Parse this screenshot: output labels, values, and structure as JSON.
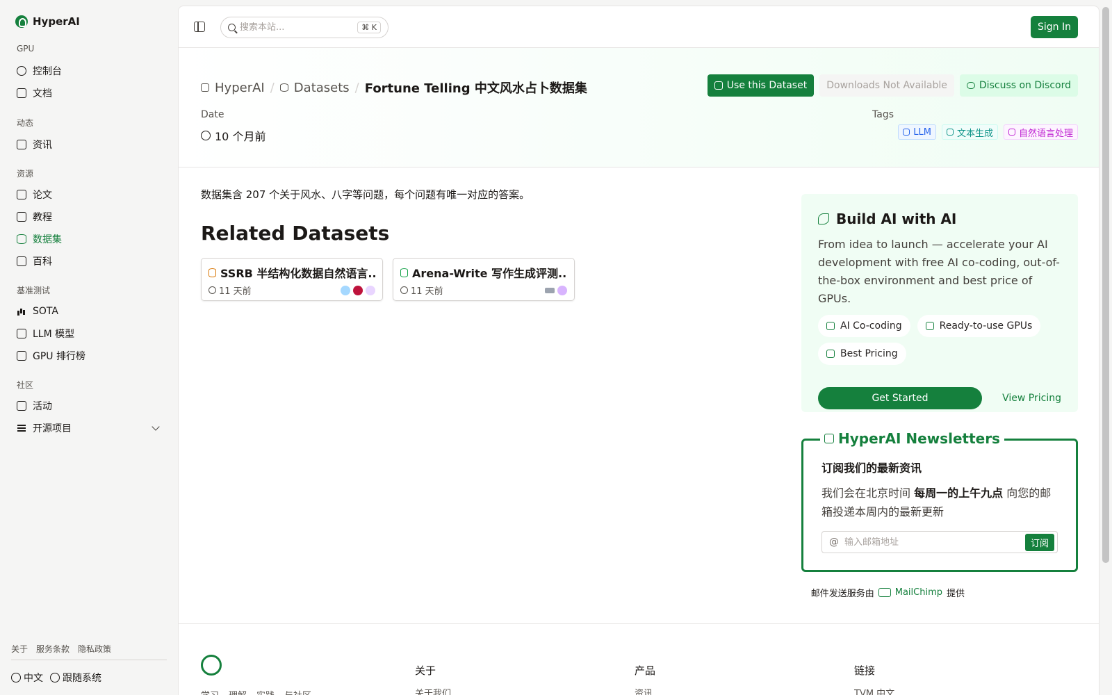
{
  "brand": "HyperAI",
  "sidebar": {
    "sections": [
      {
        "title": "GPU",
        "items": [
          {
            "label": "控制台"
          },
          {
            "label": "文档"
          }
        ]
      },
      {
        "title": "动态",
        "items": [
          {
            "label": "资讯"
          }
        ]
      },
      {
        "title": "资源",
        "items": [
          {
            "label": "论文"
          },
          {
            "label": "教程"
          },
          {
            "label": "数据集",
            "active": true
          },
          {
            "label": "百科"
          }
        ]
      },
      {
        "title": "基准测试",
        "items": [
          {
            "label": "SOTA"
          },
          {
            "label": "LLM 模型"
          },
          {
            "label": "GPU 排行榜"
          }
        ]
      },
      {
        "title": "社区",
        "items": [
          {
            "label": "活动"
          },
          {
            "label": "开源项目"
          }
        ]
      }
    ],
    "footer_links": [
      "关于",
      "服务条款",
      "隐私政策"
    ],
    "language": "中文",
    "theme": "跟随系统"
  },
  "topbar": {
    "search_placeholder": "搜索本站...",
    "search_shortcut": "⌘ K",
    "signin_label": "Sign In"
  },
  "hero": {
    "breadcrumb": [
      "HyperAI",
      "Datasets",
      "Fortune Telling 中文风水占卜数据集"
    ],
    "buttons": {
      "use": "Use this Dataset",
      "downloads": "Downloads Not Available",
      "discord": "Discuss on Discord"
    },
    "date_label": "Date",
    "date_value": "10 个月前",
    "tags_label": "Tags",
    "tags": [
      {
        "label": "LLM",
        "color": "#2563eb"
      },
      {
        "label": "文本生成",
        "color": "#0d9488"
      },
      {
        "label": "自然语言处理",
        "color": "#c026d3"
      }
    ]
  },
  "main": {
    "description": "数据集含 207 个关于风水、八字等问题，每个问题有唯一对应的答案。",
    "related_title": "Related Datasets",
    "related": [
      {
        "title": "SSRB 半结构化数据自然语言...",
        "time": "11 天前",
        "icon_color": "#d97706"
      },
      {
        "title": "Arena-Write 写作生成评测...",
        "time": "11 天前",
        "icon_color": "#16a34a"
      }
    ]
  },
  "promo": {
    "title": "Build AI with AI",
    "text": "From idea to launch — accelerate your AI development with free AI co-coding, out-of-the-box environment and best price of GPUs.",
    "chips": [
      "AI Co-coding",
      "Ready-to-use GPUs",
      "Best Pricing"
    ],
    "get_started": "Get Started",
    "view_pricing": "View Pricing"
  },
  "newsletter": {
    "title": "HyperAI Newsletters",
    "heading": "订阅我们的最新资讯",
    "text_pre": "我们会在北京时间",
    "text_bold": "每周一的上午九点",
    "text_post": "向您的邮箱投递本周内的最新更新",
    "email_placeholder": "输入邮箱地址",
    "subscribe": "订阅",
    "credit_pre": "邮件发送服务由",
    "credit_brand": "MailChimp",
    "credit_post": "提供"
  },
  "footer": {
    "columns": [
      {
        "title": "关于",
        "item": "关于我们"
      },
      {
        "title": "产品",
        "item": "资讯"
      },
      {
        "title": "链接",
        "item": "TVM 中文"
      }
    ],
    "sub_links": [
      "学习",
      "理解",
      "实践",
      "与社区"
    ]
  }
}
